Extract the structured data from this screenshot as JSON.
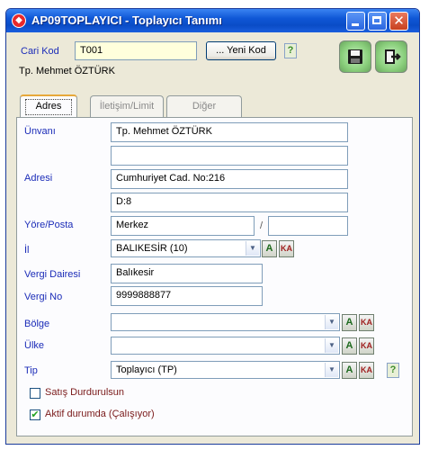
{
  "window": {
    "title": "AP09TOPLAYICI - Toplayıcı Tanımı",
    "app_icon": "app-logo-icon",
    "controls": {
      "minimize": "minimize-icon",
      "maximize": "maximize-icon",
      "close": "close-icon",
      "close_glyph": "✕"
    }
  },
  "header": {
    "cari_kod_label": "Cari Kod",
    "cari_kod_value": "T001",
    "new_code_button": "... Yeni Kod",
    "help_glyph": "?",
    "name": "Tp. Mehmet ÖZTÜRK",
    "save_icon": "floppy-disk-icon",
    "exit_icon": "exit-door-icon"
  },
  "tabs": [
    {
      "label": "Adres",
      "active": true
    },
    {
      "label": "İletişim/Limit",
      "active": false
    },
    {
      "label": "Diğer",
      "active": false
    }
  ],
  "form": {
    "unvan_label": "Ünvanı",
    "unvan_1": "Tp. Mehmet ÖZTÜRK",
    "unvan_2": "",
    "adres_label": "Adresi",
    "adres_1": "Cumhuriyet Cad. No:216",
    "adres_2": "D:8",
    "yore_label": "Yöre/Posta",
    "yore_value": "Merkez",
    "slash": "/",
    "posta_value": "",
    "il_label": "İl",
    "il_value": "BALIKESİR (10)",
    "vergi_dairesi_label": "Vergi Dairesi",
    "vergi_dairesi_value": "Balıkesir",
    "vergi_no_label": "Vergi No",
    "vergi_no_value": "9999888877",
    "bolge_label": "Bölge",
    "bolge_value": "",
    "ulke_label": "Ülke",
    "ulke_value": "",
    "tip_label": "Tip",
    "tip_value": "Toplayıcı (TP)",
    "satis_label": "Satış Durdurulsun",
    "satis_checked": false,
    "aktif_label": "Aktif durumda (Çalışıyor)",
    "aktif_checked": true,
    "a_glyph": "A",
    "ka_glyph": "KA",
    "check_glyph": "✔",
    "arrow_glyph": "▼"
  },
  "colors": {
    "label_blue": "#1b2cb8",
    "titlebar_blue": "#0a4cc6",
    "window_bg": "#ece9d8",
    "checkbox_label": "#7a1a1a"
  }
}
